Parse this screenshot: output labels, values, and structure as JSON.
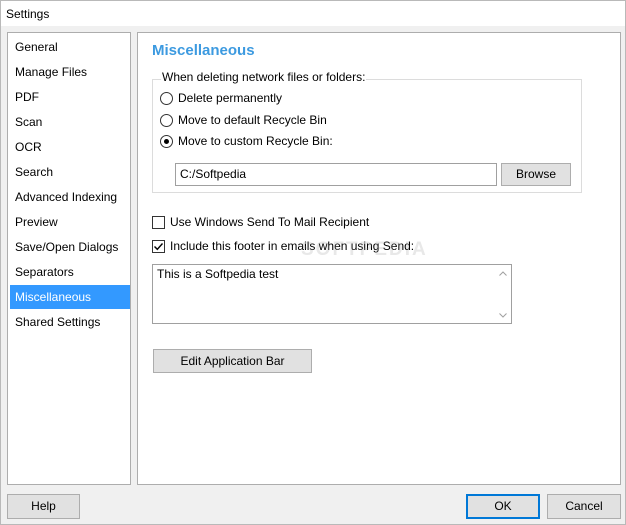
{
  "window": {
    "title": "Settings"
  },
  "sidebar": {
    "items": [
      {
        "label": "General"
      },
      {
        "label": "Manage Files"
      },
      {
        "label": "PDF"
      },
      {
        "label": "Scan"
      },
      {
        "label": "OCR"
      },
      {
        "label": "Search"
      },
      {
        "label": "Advanced Indexing"
      },
      {
        "label": "Preview"
      },
      {
        "label": "Save/Open Dialogs"
      },
      {
        "label": "Separators"
      },
      {
        "label": "Miscellaneous",
        "selected": true
      },
      {
        "label": "Shared Settings"
      }
    ]
  },
  "main": {
    "section_title": "Miscellaneous",
    "delete_group": {
      "label": "When deleting network files or folders:",
      "options": [
        {
          "label": "Delete permanently",
          "checked": false
        },
        {
          "label": "Move to default Recycle Bin",
          "checked": false
        },
        {
          "label": "Move to custom Recycle Bin:",
          "checked": true
        }
      ],
      "path_value": "C:/Softpedia",
      "browse_label": "Browse"
    },
    "send_to_mail": {
      "label": "Use Windows Send To Mail Recipient",
      "checked": false
    },
    "include_footer": {
      "label": "Include this footer in emails when using Send:",
      "checked": true
    },
    "footer_text": "This is a Softpedia test",
    "edit_app_bar_label": "Edit Application Bar",
    "watermark": "SOFTPEDIA"
  },
  "buttons": {
    "help": "Help",
    "ok": "OK",
    "cancel": "Cancel"
  },
  "colors": {
    "accent": "#3399ff",
    "section_title": "#3c9ae0",
    "default_button_border": "#0078d7"
  }
}
